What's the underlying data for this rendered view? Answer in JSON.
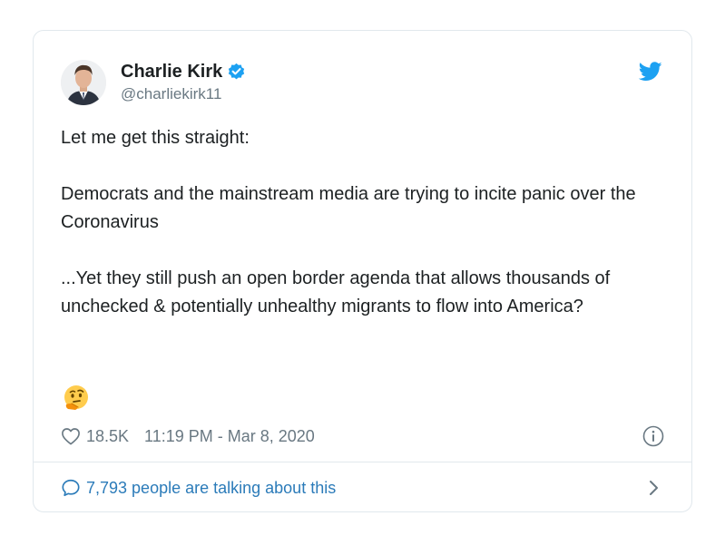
{
  "tweet": {
    "author": {
      "display_name": "Charlie Kirk",
      "handle": "@charliekirk11",
      "verified": true
    },
    "paragraphs": [
      "Let me get this straight:",
      "Democrats and the mainstream media are trying to incite panic over the Coronavirus",
      "...Yet they still push an open border agenda that allows thousands of unchecked & potentially unhealthy migrants to flow into America?"
    ],
    "emoji": "thinking-face",
    "likes": "18.5K",
    "timestamp": "11:19 PM - Mar 8, 2020",
    "talking": "7,793 people are talking about this"
  },
  "colors": {
    "brand_blue": "#1da1f2",
    "link_blue": "#2b7bb9",
    "muted": "#697882",
    "text": "#1c2022",
    "border": "#e1e8ed"
  },
  "icons": [
    "verified-badge-icon",
    "twitter-bird-icon",
    "heart-icon",
    "info-icon",
    "speech-bubble-icon",
    "chevron-right-icon",
    "thinking-face-emoji"
  ]
}
